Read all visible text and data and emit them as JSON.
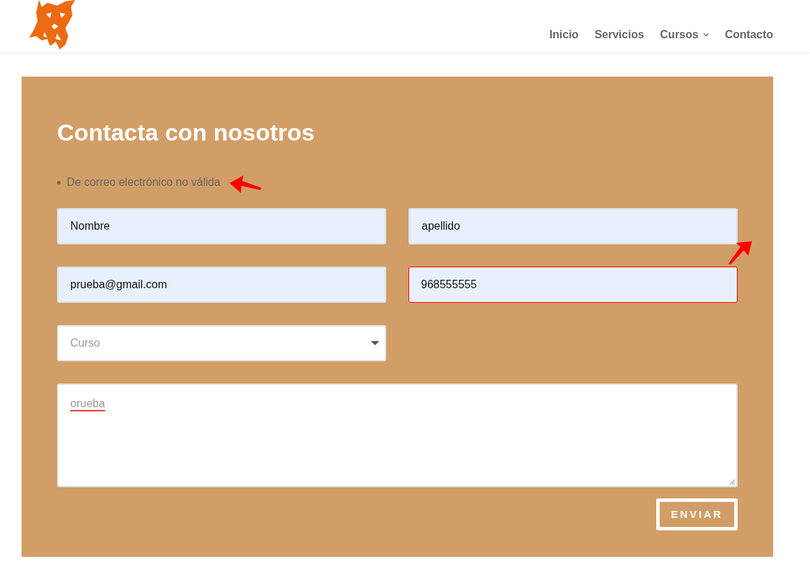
{
  "nav": [
    {
      "label": "Inicio",
      "dropdown": false
    },
    {
      "label": "Servicios",
      "dropdown": false
    },
    {
      "label": "Cursos",
      "dropdown": true
    },
    {
      "label": "Contacto",
      "dropdown": false
    }
  ],
  "form": {
    "title": "Contacta con nosotros",
    "errors": [
      {
        "text": "De correo electrónico no válida",
        "marked": true
      }
    ],
    "fields": [
      {
        "kind": "input",
        "value": "Nombre",
        "invalid": false,
        "marked": false
      },
      {
        "kind": "input",
        "value": "apellido",
        "invalid": false,
        "marked": false
      },
      {
        "kind": "input",
        "value": "prueba@gmail.com",
        "invalid": false,
        "marked": false
      },
      {
        "kind": "input",
        "value": "968555555",
        "invalid": true,
        "marked": true
      },
      {
        "kind": "select",
        "placeholder": "Curso",
        "invalid": false,
        "marked": false
      },
      {
        "kind": "textarea",
        "value": "orueba",
        "misspelled": true,
        "invalid": false,
        "marked": false
      }
    ],
    "submit": "ENVIAR"
  }
}
